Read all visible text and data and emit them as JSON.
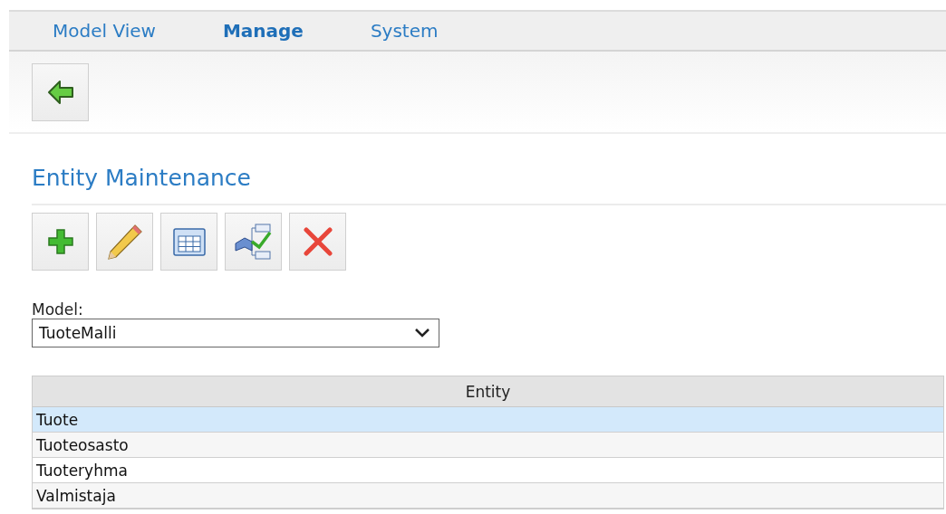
{
  "tabs": [
    {
      "label": "Model View",
      "selected": false
    },
    {
      "label": "Manage",
      "selected": true
    },
    {
      "label": "System",
      "selected": false
    }
  ],
  "title": "Entity Maintenance",
  "model": {
    "label": "Model:",
    "value": "TuoteMalli"
  },
  "table": {
    "columns": [
      "Entity"
    ],
    "rows": [
      {
        "cells": [
          "Tuote"
        ],
        "selected": true
      },
      {
        "cells": [
          "Tuoteosasto"
        ],
        "selected": false
      },
      {
        "cells": [
          "Tuoteryhma"
        ],
        "selected": false
      },
      {
        "cells": [
          "Valmistaja"
        ],
        "selected": false
      }
    ]
  }
}
